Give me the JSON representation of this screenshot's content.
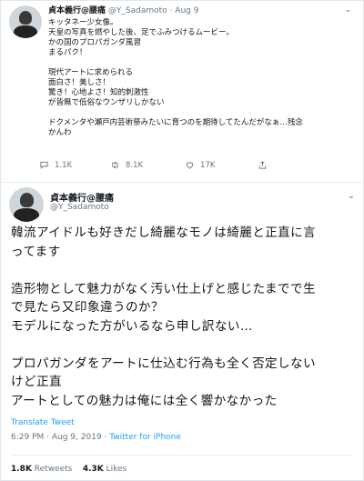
{
  "tweet1": {
    "name": "貞本義行@腰痛",
    "handle": "@Y_Sadamoto",
    "dot": "·",
    "date": "Aug 9",
    "lines": [
      "キッタネー少女像。",
      "天皇の写真を燃やした後、足でふみつけるムービー。",
      "かの国のプロパガンダ風習",
      "まるパク！",
      "",
      "現代アートに求められる",
      "面白さ！美しさ！",
      "驚き！心地よさ！知的刺激性",
      "が皆無で低俗なウンザリしかない",
      "",
      "ドクメンタや瀬戸内芸術祭みたいに育つのを期待してたんだがなぁ…残念",
      "かんわ"
    ],
    "replies": "1.1K",
    "retweets": "8.1K",
    "likes": "17K"
  },
  "tweet2": {
    "name": "貞本義行@腰痛",
    "handle": "@Y_Sadamoto",
    "lines": [
      "韓流アイドルも好きだし綺麗なモノは綺麗と正直に言",
      "ってます",
      "",
      "造形物として魅力がなく汚い仕上げと感じたまでで生",
      "で見たら又印象違うのか？",
      "モデルになった方がいるなら申し訳ない…",
      "",
      "プロパガンダをアートに仕込む行為も全く否定しない",
      "けど正直",
      "アートとしての魅力は俺には全く響かなかった"
    ],
    "translate": "Translate Tweet",
    "time": "6:29 PM",
    "date": "Aug 9, 2019",
    "source": "Twitter for iPhone",
    "retweets_count": "1.8K",
    "retweets_label": "Retweets",
    "likes_count": "4.3K",
    "likes_label": "Likes"
  },
  "icons": {
    "caret": "chevron-down-icon",
    "reply": "reply-icon",
    "retweet": "retweet-icon",
    "like": "heart-icon"
  },
  "colors": {
    "link": "#1da1f2",
    "muted": "#657786",
    "text": "#14171a"
  }
}
